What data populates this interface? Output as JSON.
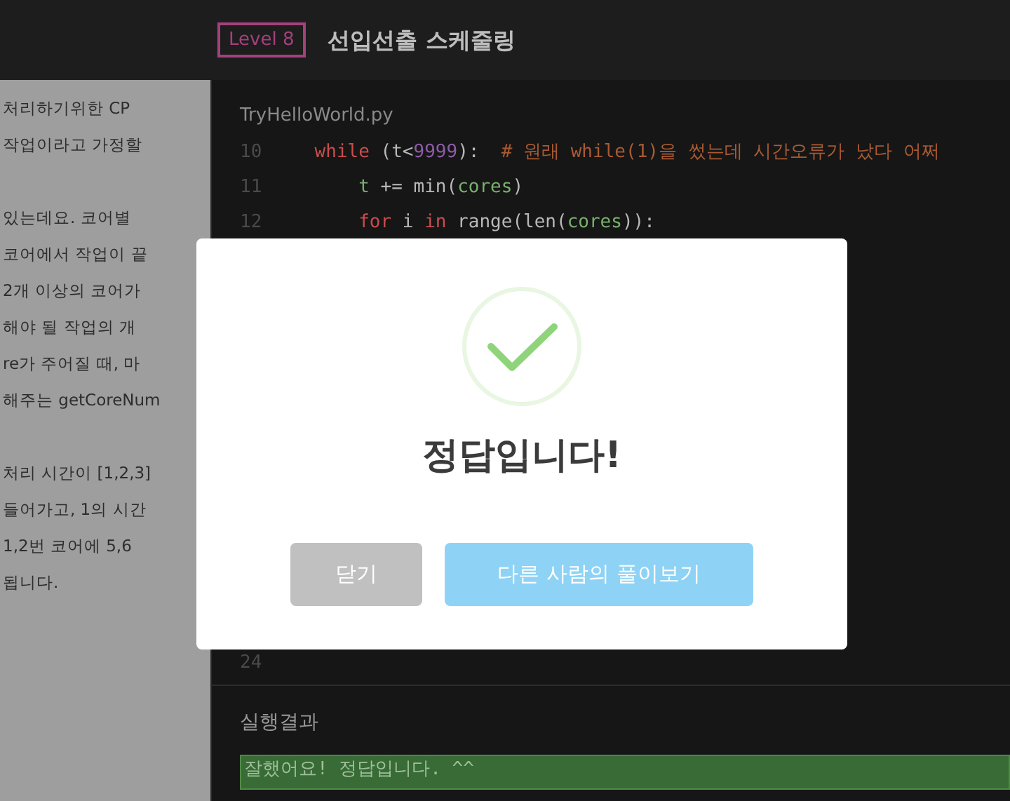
{
  "header": {
    "level_badge": "Level 8",
    "title": "선입선출 스케줄링"
  },
  "description": {
    "paragraphs": [
      [
        "처리하기위한 CP",
        "작업이라고 가정할"
      ],
      [
        "있는데요. 코어별",
        "코어에서 작업이 끝",
        "2개 이상의 코어가",
        "해야 될 작업의 개",
        "re가 주어질 때, 마",
        "해주는 getCoreNum"
      ],
      [
        "처리 시간이 [1,2,3]",
        "들어가고, 1의 시간",
        "1,2번 코어에 5,6",
        "됩니다."
      ]
    ]
  },
  "editor": {
    "filename": "TryHelloWorld.py",
    "lines": [
      {
        "number": "10",
        "tokens": [
          {
            "kind": "keyword",
            "text": "while"
          },
          {
            "kind": "plain",
            "text": " (t<"
          },
          {
            "kind": "number",
            "text": "9999"
          },
          {
            "kind": "plain",
            "text": "):  "
          },
          {
            "kind": "comment",
            "text": "# 원래 while(1)을 썼는데 시간오류가 났다 어쩌"
          }
        ],
        "children": [
          {
            "number": "11",
            "tokens": [
              {
                "kind": "name",
                "text": "t"
              },
              {
                "kind": "plain",
                "text": " += min("
              },
              {
                "kind": "name",
                "text": "cores"
              },
              {
                "kind": "plain",
                "text": ")"
              }
            ]
          },
          {
            "number": "12",
            "tokens": [
              {
                "kind": "keyword",
                "text": "for"
              },
              {
                "kind": "plain",
                "text": " i "
              },
              {
                "kind": "keyword",
                "text": "in"
              },
              {
                "kind": "plain",
                "text": " range(len("
              },
              {
                "kind": "name",
                "text": "cores"
              },
              {
                "kind": "plain",
                "text": ")):"
              }
            ]
          }
        ]
      }
    ],
    "last_line": {
      "number": "24"
    }
  },
  "result": {
    "label": "실행결과",
    "output": "잘했어요! 정답입니다. ^^"
  },
  "modal": {
    "title": "정답입니다!",
    "buttons": [
      {
        "label": "닫기",
        "kind": "secondary"
      },
      {
        "label": "다른 사람의 풀이보기",
        "kind": "primary"
      }
    ]
  }
}
